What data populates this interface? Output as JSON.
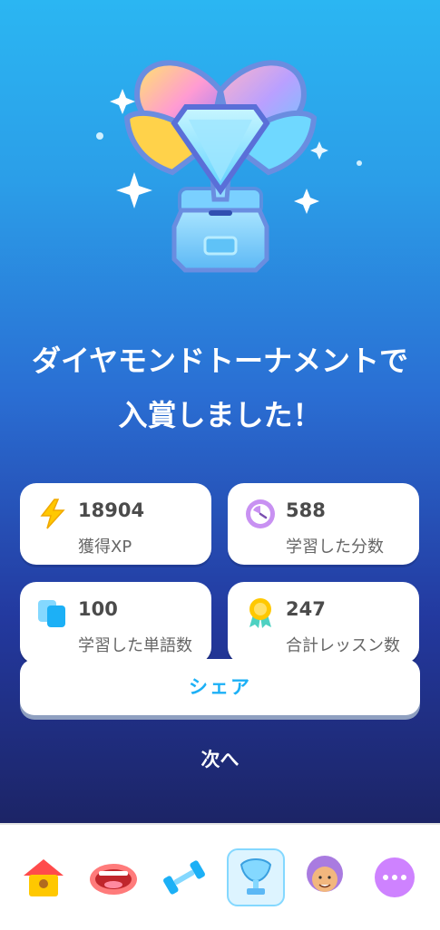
{
  "headline": {
    "line1": "ダイヤモンドトーナメントで",
    "line2": "入賞しました！"
  },
  "stats": [
    {
      "value": "18904",
      "label": "獲得XP",
      "icon": "lightning-icon"
    },
    {
      "value": "588",
      "label": "学習した分数",
      "icon": "clock-icon"
    },
    {
      "value": "100",
      "label": "学習した単語数",
      "icon": "cards-icon"
    },
    {
      "value": "247",
      "label": "合計レッスン数",
      "icon": "medal-icon"
    }
  ],
  "buttons": {
    "share": "シェア",
    "next": "次へ"
  },
  "tabs": [
    {
      "name": "home",
      "icon": "house-icon"
    },
    {
      "name": "speaking",
      "icon": "mouth-icon"
    },
    {
      "name": "practice",
      "icon": "dumbbell-icon"
    },
    {
      "name": "leaderboard",
      "icon": "trophy-icon",
      "active": true
    },
    {
      "name": "profile",
      "icon": "avatar-icon"
    },
    {
      "name": "more",
      "icon": "more-icon"
    }
  ],
  "colors": {
    "accent": "#1cb0f6",
    "gradient_top": "#2bb6f2",
    "gradient_bottom": "#1c2466"
  }
}
